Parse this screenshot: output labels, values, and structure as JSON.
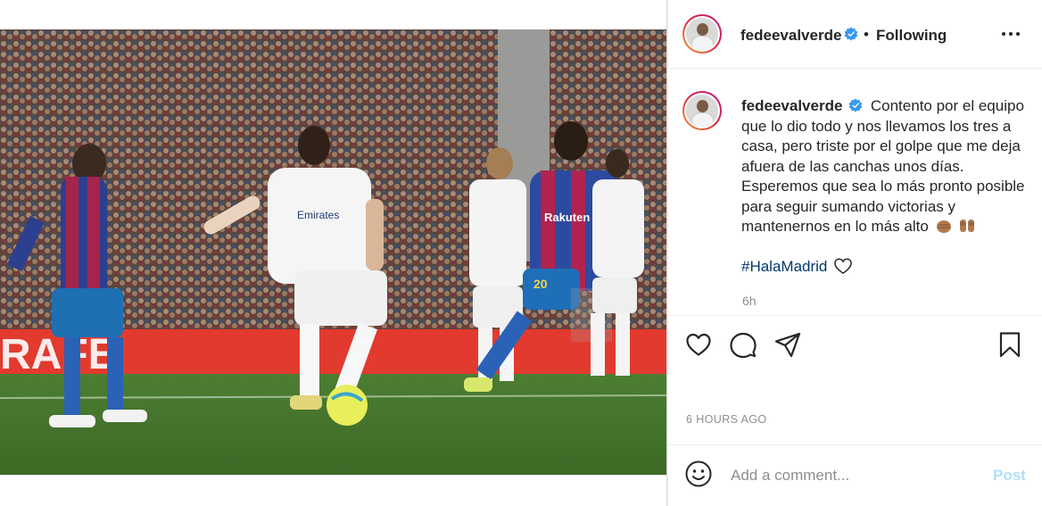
{
  "post": {
    "photo_alt": "",
    "header": {
      "username": "fedeevalverde",
      "separator": "•",
      "follow_status": "Following"
    },
    "caption": {
      "username": "fedeevalverde",
      "body": "Contento por el equipo que lo dio todo y nos llevamos los tres a casa, pero triste por el golpe que me deja afuera de las canchas unos días. Esperemos que sea lo más pronto posible para seguir sumando victorias y mantenernos en lo más alto",
      "hashtag": "#HalaMadrid",
      "relative_time": "6h"
    },
    "actions": {
      "like_icon": "heart-icon",
      "comment_icon": "comment-bubble-icon",
      "share_icon": "paper-plane-icon",
      "save_icon": "bookmark-icon"
    },
    "posted_ago": "6 HOURS AGO",
    "comment": {
      "placeholder": "Add a comment...",
      "post_label": "Post"
    },
    "colors": {
      "text": "#262626",
      "muted": "#8e8e8e",
      "verified": "#3897f0",
      "post_button": "#b2dffc",
      "border": "#efefef"
    }
  }
}
